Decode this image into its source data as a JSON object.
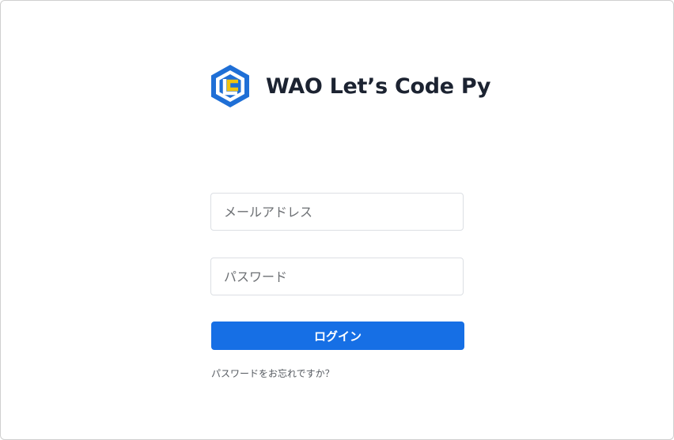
{
  "app": {
    "name": "WAO Let’s Code Py",
    "brand_colors": {
      "hexagon": "#1f6fd6",
      "letter": "#f1c40f"
    }
  },
  "form": {
    "email_placeholder": "メールアドレス",
    "password_placeholder": "パスワード",
    "login_label": "ログイン",
    "forgot_link": "パスワードをお忘れですか？",
    "accent_color": "#166fe5"
  }
}
